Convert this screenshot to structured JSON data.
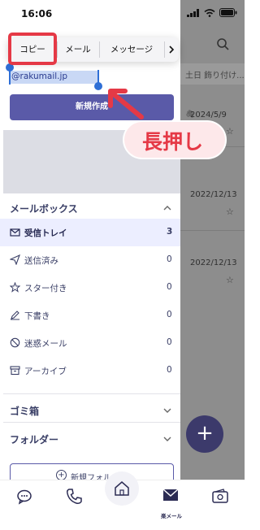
{
  "status_bar": {
    "time": "16:06"
  },
  "context_menu": {
    "items": [
      "コピー",
      "メール",
      "メッセージ"
    ],
    "more_icon": "chevron-right-icon"
  },
  "account": {
    "email": "@rakumail.jp"
  },
  "new_mail_button": "新規作成",
  "mailbox_section": {
    "title": "メールボックス"
  },
  "folders": [
    {
      "label": "受信トレイ",
      "count": "3",
      "icon": "mail-icon"
    },
    {
      "label": "送信済み",
      "count": "0",
      "icon": "send-icon"
    },
    {
      "label": "スター付き",
      "count": "0",
      "icon": "star-icon"
    },
    {
      "label": "下書き",
      "count": "0",
      "icon": "pencil-icon"
    },
    {
      "label": "迷惑メール",
      "count": "0",
      "icon": "block-icon"
    },
    {
      "label": "アーカイブ",
      "count": "0",
      "icon": "archive-icon"
    }
  ],
  "trash_section": {
    "title": "ゴミ箱"
  },
  "folder_section": {
    "title": "フォルダー"
  },
  "new_folder_button": "新規フォル",
  "background_list": {
    "banner_text": "土日 飾り付け...",
    "dates": [
      "2024/5/9",
      "2022/12/13",
      "2022/12/13"
    ]
  },
  "bottom_nav": {
    "active_label": "楽メール"
  },
  "annotation": {
    "text": "長押し"
  },
  "colors": {
    "accent": "#5a5aa8",
    "highlight_red": "#e53946",
    "selection_blue": "#2f6fd6"
  }
}
